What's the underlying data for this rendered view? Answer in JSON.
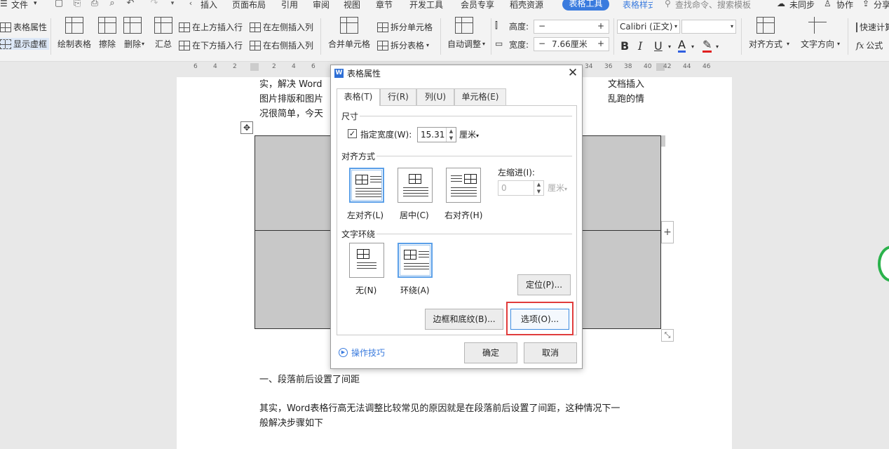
{
  "menu": {
    "file": "文件",
    "tabs": [
      "插入",
      "页面布局",
      "引用",
      "审阅",
      "视图",
      "章节",
      "开发工具",
      "会员专享",
      "稻壳资源"
    ],
    "table_tools": "表格工具",
    "table_style": "表格样式",
    "search_placeholder": "查找命令、搜索模板",
    "not_synced": "未同步",
    "collaborate": "协作",
    "share": "分享"
  },
  "ribbon": {
    "table_props": "表格属性",
    "show_gridlines": "显示虚框",
    "draw_table": "绘制表格",
    "erase": "擦除",
    "delete": "删除",
    "summary": "汇总",
    "insert_above": "在上方插入行",
    "insert_below": "在下方插入行",
    "insert_left": "在左侧插入列",
    "insert_right": "在右侧插入列",
    "merge_cells": "合并单元格",
    "split_cells": "拆分单元格",
    "split_table": "拆分表格",
    "auto_fit": "自动调整",
    "height_label": "高度:",
    "width_label": "宽度:",
    "width_value": "7.66厘米",
    "font_name": "Calibri (正文)",
    "align_label": "对齐方式",
    "text_dir": "文字方向",
    "quick_calc": "快速计算",
    "formula": "公式"
  },
  "ruler": [
    "6",
    "4",
    "2",
    "2",
    "4",
    "6",
    "34",
    "36",
    "38",
    "40",
    "42",
    "44",
    "46"
  ],
  "document": {
    "line1_a": "实，解决 Word",
    "line1_b": "文档插入",
    "line2_a": "图片排版和图片",
    "line2_b": "乱跑的情",
    "line3_a": "况很简单，今天",
    "heading1": "一、段落前后设置了间距",
    "para1_l1": "其实，Word表格行高无法调整比较常见的原因就是在段落前后设置了间距，这种情况下一",
    "para1_l2": "般解决步骤如下"
  },
  "dialog": {
    "title": "表格属性",
    "tabs": [
      "表格(T)",
      "行(R)",
      "列(U)",
      "单元格(E)"
    ],
    "size_group": "尺寸",
    "specify_width": "指定宽度(W):",
    "width_value": "15.31",
    "width_unit": "厘米",
    "align_group": "对齐方式",
    "align_options": [
      "左对齐(L)",
      "居中(C)",
      "右对齐(H)"
    ],
    "indent_label": "左缩进(I):",
    "indent_value": "0",
    "indent_unit": "厘米",
    "wrap_group": "文字环绕",
    "wrap_options": [
      "无(N)",
      "环绕(A)"
    ],
    "position_btn": "定位(P)...",
    "borders_btn": "边框和底纹(B)...",
    "options_btn": "选项(O)...",
    "tips": "操作技巧",
    "ok": "确定",
    "cancel": "取消"
  }
}
